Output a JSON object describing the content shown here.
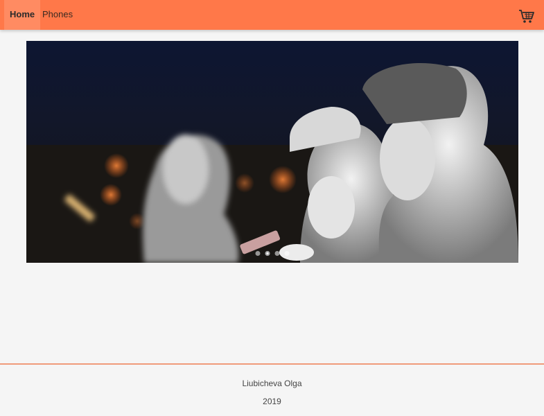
{
  "nav": {
    "items": [
      {
        "label": "Home",
        "active": true
      },
      {
        "label": "Phones",
        "active": false
      }
    ],
    "cart_icon": "shopping-cart-icon",
    "accent_color": "#ff7849"
  },
  "carousel": {
    "slide_count": 4,
    "active_index": 1,
    "image_description": "statues of people looking at phones at night"
  },
  "footer": {
    "author": "Liubicheva Olga",
    "year": "2019",
    "border_color": "#f09a7a"
  }
}
